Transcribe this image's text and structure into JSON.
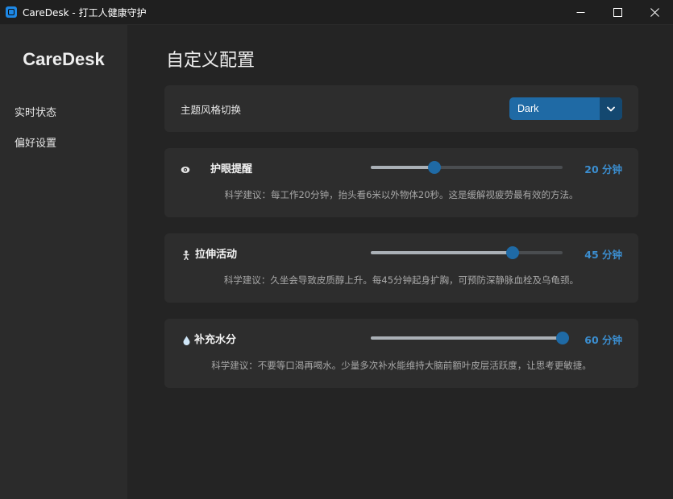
{
  "window": {
    "title": "CareDesk - 打工人健康守护",
    "icon": "app-icon",
    "controls": [
      "minimize-icon",
      "maximize-icon",
      "close-icon"
    ]
  },
  "sidebar": {
    "logo": "CareDesk",
    "items": [
      {
        "label": "实时状态"
      },
      {
        "label": "偏好设置"
      }
    ]
  },
  "main": {
    "title": "自定义配置",
    "theme": {
      "label": "主题风格切换",
      "selected": "Dark"
    },
    "settings": [
      {
        "icon": "eye-icon",
        "title": "护眼提醒",
        "slider_fraction": 0.33,
        "value": "20 分钟",
        "tip": "科学建议：每工作20分钟，抬头看6米以外物体20秒。这是缓解视疲劳最有效的方法。"
      },
      {
        "icon": "stretch-person-icon",
        "title": "拉伸活动",
        "slider_fraction": 0.74,
        "value": "45 分钟",
        "tip": "科学建议：久坐会导致皮质醇上升。每45分钟起身扩胸，可预防深静脉血栓及乌龟颈。"
      },
      {
        "icon": "water-drop-icon",
        "title": "补充水分",
        "slider_fraction": 1.0,
        "value": "60 分钟",
        "tip": "科学建议：不要等口渴再喝水。少量多次补水能维持大脑前额叶皮层活跃度，让思考更敏捷。"
      }
    ]
  },
  "colors": {
    "accent": "#1f6aa5",
    "accent_dark": "#144870",
    "value_text": "#3b8ed0",
    "sidebar_bg": "#2b2b2b",
    "main_bg": "#242424",
    "card_bg": "#2d2d2d"
  }
}
